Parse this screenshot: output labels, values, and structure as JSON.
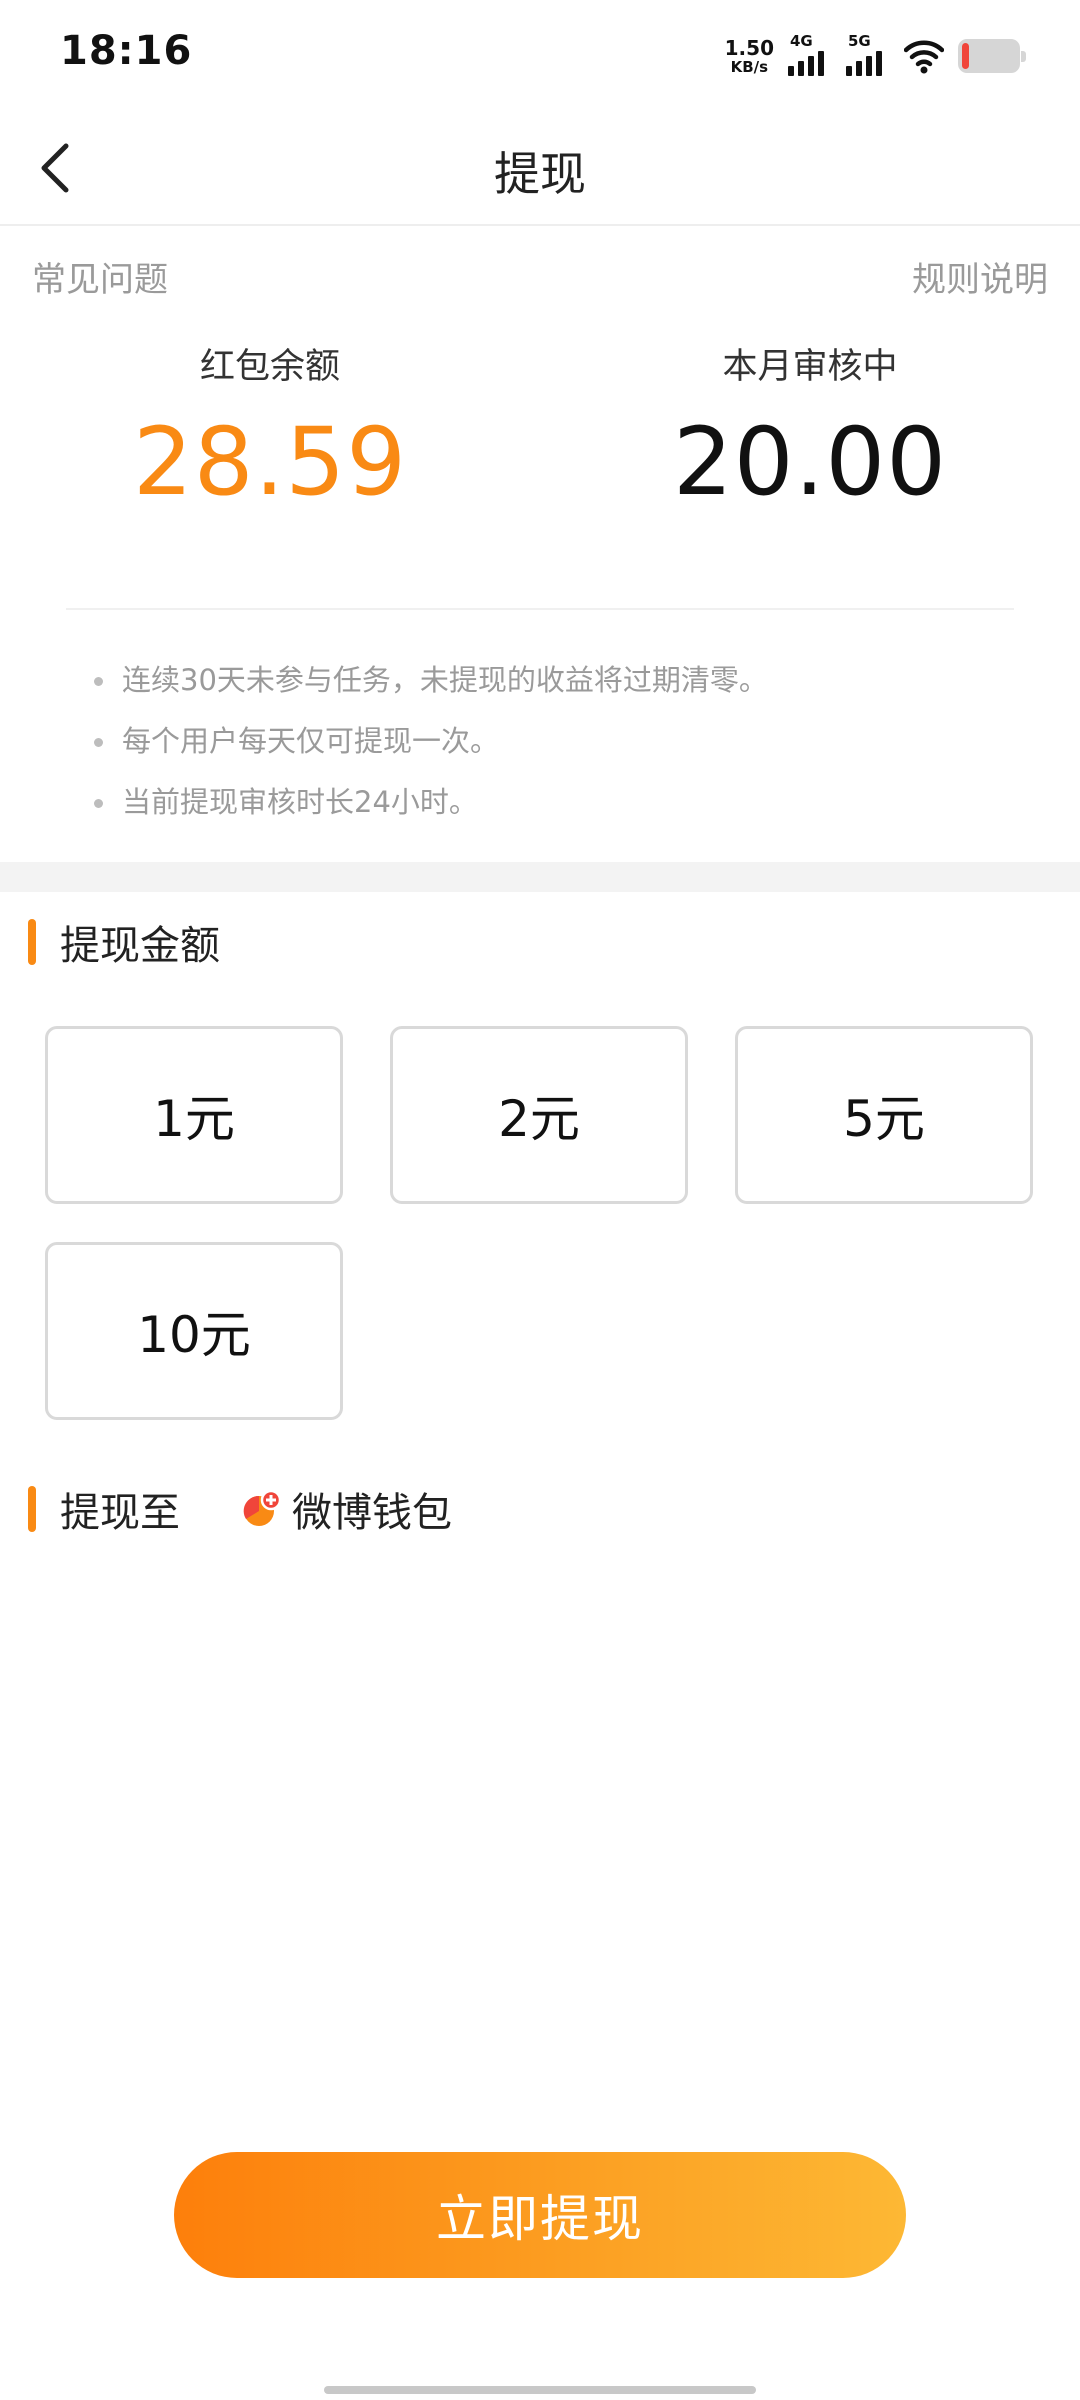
{
  "status_bar": {
    "time": "18:16",
    "net_speed_value": "1.50",
    "net_speed_unit": "KB/s",
    "signal_1_label": "4G",
    "signal_2_label": "5G"
  },
  "header": {
    "title": "提现"
  },
  "links": {
    "faq": "常见问题",
    "rules": "规则说明"
  },
  "balances": {
    "red_packet_label": "红包余额",
    "red_packet_value": "28.59",
    "reviewing_label": "本月审核中",
    "reviewing_value": "20.00"
  },
  "notes": [
    "连续30天未参与任务，未提现的收益将过期清零。",
    "每个用户每天仅可提现一次。",
    "当前提现审核时长24小时。"
  ],
  "amount_section": {
    "title": "提现金额",
    "options": [
      "1元",
      "2元",
      "5元",
      "10元"
    ]
  },
  "destination_section": {
    "title": "提现至",
    "wallet_name": "微博钱包"
  },
  "submit_label": "立即提现",
  "colors": {
    "accent": "#f98a14",
    "gradient_start": "#fd7f0b",
    "gradient_end": "#fdb834",
    "battery_low": "#f0453a"
  },
  "icons": {
    "back": "back-arrow-icon",
    "wallet": "weibo-wallet-icon",
    "wifi": "wifi-icon",
    "battery": "battery-icon"
  }
}
